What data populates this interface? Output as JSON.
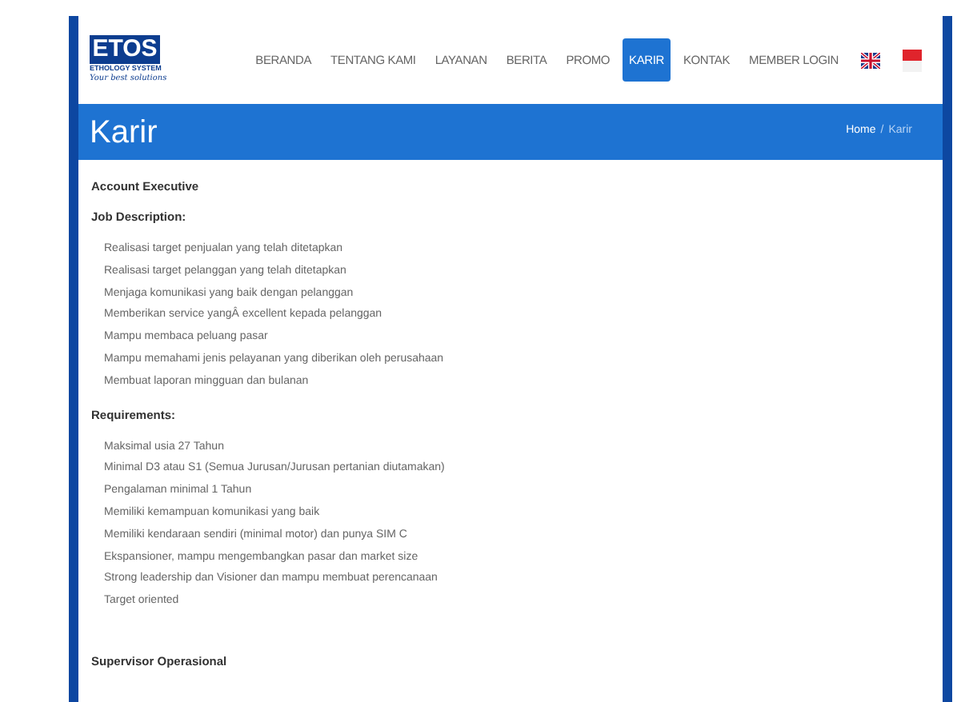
{
  "logo": {
    "name": "ETOS",
    "subtitle": "ETHOLOGY SYSTEM",
    "tagline": "Your best solutions"
  },
  "nav": [
    {
      "label": "BERANDA",
      "selected": false
    },
    {
      "label": "TENTANG KAMI",
      "selected": false
    },
    {
      "label": "LAYANAN",
      "selected": false
    },
    {
      "label": "BERITA",
      "selected": false
    },
    {
      "label": "PROMO",
      "selected": false
    },
    {
      "label": "KARIR",
      "selected": true
    },
    {
      "label": "KONTAK",
      "selected": false
    },
    {
      "label": "MEMBER LOGIN",
      "selected": false
    }
  ],
  "banner": {
    "title": "Karir",
    "breadcrumb": [
      {
        "label": "Home",
        "selected": false
      },
      {
        "label": "Karir",
        "selected": true
      }
    ],
    "separator": "/"
  },
  "jobs": [
    {
      "title": "Account Executive",
      "sections": [
        {
          "heading": "Job Description:",
          "items": [
            "Realisasi target penjualan yang telah ditetapkan",
            "Realisasi target pelanggan yang telah ditetapkan",
            "Menjaga komunikasi yang baik dengan pelanggan",
            "Memberikan service yangÂ excellent kepada pelanggan",
            "Mampu membaca peluang pasar",
            "Mampu memahami jenis pelayanan yang diberikan oleh perusahaan",
            "Membuat laporan mingguan dan bulanan"
          ]
        },
        {
          "heading": "Requirements:",
          "items": [
            "Maksimal usia 27 Tahun",
            "Minimal D3 atau S1 (Semua Jurusan/Jurusan pertanian diutamakan)",
            "Pengalaman minimal 1 Tahun",
            "Memiliki kemampuan komunikasi yang baik",
            "Memiliki kendaraan sendiri (minimal motor) dan punya SIM C",
            "Ekspansioner, mampu mengembangkan pasar dan market size",
            "Strong leadership dan Visioner dan mampu membuat perencanaan",
            "Target oriented"
          ]
        }
      ]
    },
    {
      "title": "Supervisor Operasional"
    }
  ]
}
